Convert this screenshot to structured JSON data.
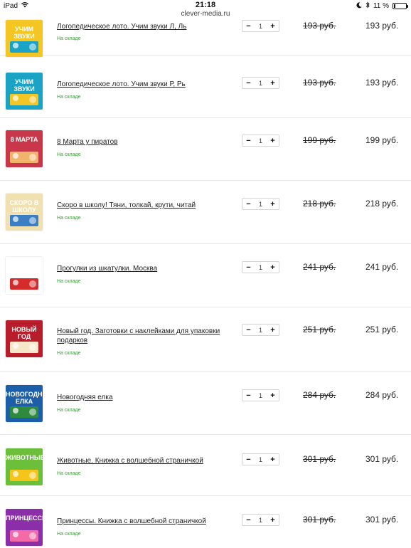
{
  "status": {
    "device": "iPad",
    "time": "21:18",
    "battery": "11 %",
    "battery_level": 0.11
  },
  "browser": {
    "domain": "clever-media.ru"
  },
  "cart": {
    "items": [
      {
        "title": "Логопедическое лото. Учим звуки Л, Ль",
        "stock": "На складе",
        "qty": "1",
        "old_price": "193 руб.",
        "price": "193 руб.",
        "thumb_text": "УЧИМ ЗВУКИ",
        "thumb_color": "#f3c623",
        "thumb_accent": "#1aa3c4"
      },
      {
        "title": "Логопедическое лото. Учим звуки Р, Рь",
        "stock": "На складе",
        "qty": "1",
        "old_price": "193 руб.",
        "price": "193 руб.",
        "thumb_text": "УЧИМ ЗВУКИ",
        "thumb_color": "#1aa3c4",
        "thumb_accent": "#f3c623"
      },
      {
        "title": "8 Марта у пиратов",
        "stock": "На складе",
        "qty": "1",
        "old_price": "199 руб.",
        "price": "199 руб.",
        "thumb_text": "8 МАРТА",
        "thumb_color": "#c9384a",
        "thumb_accent": "#f2b46b"
      },
      {
        "title": "Скоро в школу! Тяни, толкай, крути, читай",
        "stock": "На складе",
        "qty": "1",
        "old_price": "218 руб.",
        "price": "218 руб.",
        "thumb_text": "СКОРО В ШКОЛУ",
        "thumb_color": "#f1e0b0",
        "thumb_accent": "#3a7fc4"
      },
      {
        "title": "Прогулки из шкатулки. Москва",
        "stock": "На складе",
        "qty": "1",
        "old_price": "241 руб.",
        "price": "241 руб.",
        "thumb_text": "",
        "thumb_color": "#ffffff",
        "thumb_accent": "#d52b2b"
      },
      {
        "title": "Новый год. Заготовки с наклейками для упаковки подарков",
        "stock": "На складе",
        "qty": "1",
        "old_price": "251 руб.",
        "price": "251 руб.",
        "thumb_text": "НОВЫЙ ГОД",
        "thumb_color": "#b71d2a",
        "thumb_accent": "#f6e7c8"
      },
      {
        "title": "Новогодняя елка",
        "stock": "На складе",
        "qty": "1",
        "old_price": "284 руб.",
        "price": "284 руб.",
        "thumb_text": "НОВОГОДНЯЯ ЕЛКА",
        "thumb_color": "#1c5fa8",
        "thumb_accent": "#2e8b3e"
      },
      {
        "title": "Животные. Книжка с волшебной страничкой",
        "stock": "На складе",
        "qty": "1",
        "old_price": "301 руб.",
        "price": "301 руб.",
        "thumb_text": "ЖИВОТНЫЕ",
        "thumb_color": "#6cbf3a",
        "thumb_accent": "#f6c51a"
      },
      {
        "title": "Принцессы. Книжка с волшебной страничкой",
        "stock": "На складе",
        "qty": "1",
        "old_price": "301 руб.",
        "price": "301 руб.",
        "thumb_text": "ПРИНЦЕССЫ",
        "thumb_color": "#8a2fa8",
        "thumb_accent": "#f36aa8"
      }
    ],
    "minus_label": "−",
    "plus_label": "+"
  }
}
